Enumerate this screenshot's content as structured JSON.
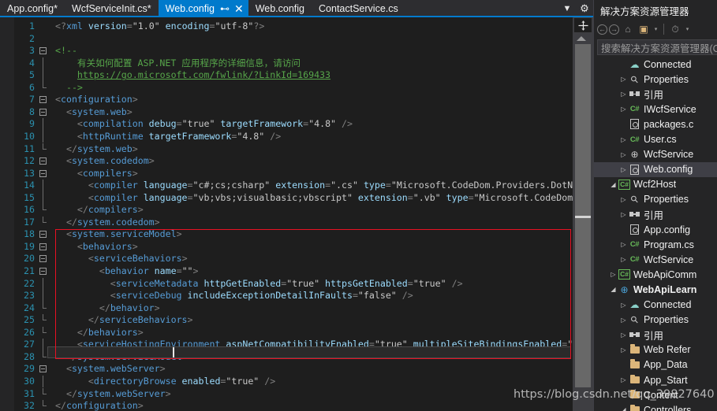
{
  "tabs": [
    {
      "label": "App.config*",
      "active": false
    },
    {
      "label": "WcfServiceInit.cs*",
      "active": false
    },
    {
      "label": "Web.config",
      "active": true,
      "pin": "⊷",
      "close": "✕"
    },
    {
      "label": "Web.config",
      "active": false
    },
    {
      "label": "ContactService.cs",
      "active": false
    }
  ],
  "tabbar_buttons": [
    {
      "name": "tab-list-dropdown",
      "glyph": "▼"
    },
    {
      "name": "tab-settings-gear",
      "glyph": "⚙"
    }
  ],
  "editor": {
    "file": "Web.config",
    "cursor_line": 28,
    "lines": [
      {
        "n": 1,
        "segs": [
          {
            "t": "<?",
            "c": "t-pitext"
          },
          {
            "t": "xml",
            "c": "t-pi"
          },
          {
            "t": " version",
            "c": "t-attr"
          },
          {
            "t": "=",
            "c": "t-punct"
          },
          {
            "t": "\"1.0\"",
            "c": "t-val"
          },
          {
            "t": " encoding",
            "c": "t-attr"
          },
          {
            "t": "=",
            "c": "t-punct"
          },
          {
            "t": "\"utf-8\"",
            "c": "t-val"
          },
          {
            "t": "?>",
            "c": "t-pitext"
          }
        ],
        "indent": 0
      },
      {
        "n": 2,
        "segs": [],
        "indent": 0
      },
      {
        "n": 3,
        "segs": [
          {
            "t": "<!--",
            "c": "t-comment"
          }
        ],
        "indent": 0,
        "fold": "start"
      },
      {
        "n": 4,
        "segs": [
          {
            "t": "    有关如何配置 ASP.NET 应用程序的详细信息，请访问",
            "c": "t-comment"
          }
        ],
        "indent": 0,
        "fold": "bar"
      },
      {
        "n": 5,
        "segs": [
          {
            "t": "    ",
            "c": "t-comment"
          },
          {
            "t": "https://go.microsoft.com/fwlink/?LinkId=169433",
            "c": "t-link"
          }
        ],
        "indent": 0,
        "fold": "bar"
      },
      {
        "n": 6,
        "segs": [
          {
            "t": "  -->",
            "c": "t-comment"
          }
        ],
        "indent": 0,
        "fold": "end"
      },
      {
        "n": 7,
        "segs": [
          {
            "t": "<",
            "c": "t-punct"
          },
          {
            "t": "configuration",
            "c": "t-tag"
          },
          {
            "t": ">",
            "c": "t-punct"
          }
        ],
        "indent": 0,
        "fold": "start"
      },
      {
        "n": 8,
        "segs": [
          {
            "t": "  <",
            "c": "t-punct"
          },
          {
            "t": "system.web",
            "c": "t-tag"
          },
          {
            "t": ">",
            "c": "t-punct"
          }
        ],
        "indent": 0,
        "fold": "start"
      },
      {
        "n": 9,
        "segs": [
          {
            "t": "    <",
            "c": "t-punct"
          },
          {
            "t": "compilation",
            "c": "t-tag"
          },
          {
            "t": " debug",
            "c": "t-attr"
          },
          {
            "t": "=",
            "c": "t-punct"
          },
          {
            "t": "\"true\"",
            "c": "t-val"
          },
          {
            "t": " targetFramework",
            "c": "t-attr"
          },
          {
            "t": "=",
            "c": "t-punct"
          },
          {
            "t": "\"4.8\"",
            "c": "t-val"
          },
          {
            "t": " />",
            "c": "t-punct"
          }
        ],
        "indent": 0,
        "fold": "bar"
      },
      {
        "n": 10,
        "segs": [
          {
            "t": "    <",
            "c": "t-punct"
          },
          {
            "t": "httpRuntime",
            "c": "t-tag"
          },
          {
            "t": " targetFramework",
            "c": "t-attr"
          },
          {
            "t": "=",
            "c": "t-punct"
          },
          {
            "t": "\"4.8\"",
            "c": "t-val"
          },
          {
            "t": " />",
            "c": "t-punct"
          }
        ],
        "indent": 0,
        "fold": "bar"
      },
      {
        "n": 11,
        "segs": [
          {
            "t": "  </",
            "c": "t-punct"
          },
          {
            "t": "system.web",
            "c": "t-tag"
          },
          {
            "t": ">",
            "c": "t-punct"
          }
        ],
        "indent": 0,
        "fold": "end"
      },
      {
        "n": 12,
        "segs": [
          {
            "t": "  <",
            "c": "t-punct"
          },
          {
            "t": "system.codedom",
            "c": "t-tag"
          },
          {
            "t": ">",
            "c": "t-punct"
          }
        ],
        "indent": 0,
        "fold": "start"
      },
      {
        "n": 13,
        "segs": [
          {
            "t": "    <",
            "c": "t-punct"
          },
          {
            "t": "compilers",
            "c": "t-tag"
          },
          {
            "t": ">",
            "c": "t-punct"
          }
        ],
        "indent": 0,
        "fold": "start"
      },
      {
        "n": 14,
        "segs": [
          {
            "t": "      <",
            "c": "t-punct"
          },
          {
            "t": "compiler",
            "c": "t-tag"
          },
          {
            "t": " language",
            "c": "t-attr"
          },
          {
            "t": "=",
            "c": "t-punct"
          },
          {
            "t": "\"c#;cs;csharp\"",
            "c": "t-val"
          },
          {
            "t": " extension",
            "c": "t-attr"
          },
          {
            "t": "=",
            "c": "t-punct"
          },
          {
            "t": "\".cs\"",
            "c": "t-val"
          },
          {
            "t": " type",
            "c": "t-attr"
          },
          {
            "t": "=",
            "c": "t-punct"
          },
          {
            "t": "\"Microsoft.CodeDom.Providers.DotNetCompiler",
            "c": "t-val"
          }
        ],
        "indent": 0,
        "fold": "bar"
      },
      {
        "n": 15,
        "segs": [
          {
            "t": "      <",
            "c": "t-punct"
          },
          {
            "t": "compiler",
            "c": "t-tag"
          },
          {
            "t": " language",
            "c": "t-attr"
          },
          {
            "t": "=",
            "c": "t-punct"
          },
          {
            "t": "\"vb;vbs;visualbasic;vbscript\"",
            "c": "t-val"
          },
          {
            "t": " extension",
            "c": "t-attr"
          },
          {
            "t": "=",
            "c": "t-punct"
          },
          {
            "t": "\".vb\"",
            "c": "t-val"
          },
          {
            "t": " type",
            "c": "t-attr"
          },
          {
            "t": "=",
            "c": "t-punct"
          },
          {
            "t": "\"Microsoft.CodeDom.Providers",
            "c": "t-val"
          }
        ],
        "indent": 0,
        "fold": "bar"
      },
      {
        "n": 16,
        "segs": [
          {
            "t": "    </",
            "c": "t-punct"
          },
          {
            "t": "compilers",
            "c": "t-tag"
          },
          {
            "t": ">",
            "c": "t-punct"
          }
        ],
        "indent": 0,
        "fold": "end"
      },
      {
        "n": 17,
        "segs": [
          {
            "t": "  </",
            "c": "t-punct"
          },
          {
            "t": "system.codedom",
            "c": "t-tag"
          },
          {
            "t": ">",
            "c": "t-punct"
          }
        ],
        "indent": 0,
        "fold": "end"
      },
      {
        "n": 18,
        "segs": [
          {
            "t": "  <",
            "c": "t-punct"
          },
          {
            "t": "system.serviceModel",
            "c": "t-tag"
          },
          {
            "t": ">",
            "c": "t-punct"
          }
        ],
        "indent": 0,
        "fold": "start"
      },
      {
        "n": 19,
        "segs": [
          {
            "t": "    <",
            "c": "t-punct"
          },
          {
            "t": "behaviors",
            "c": "t-tag"
          },
          {
            "t": ">",
            "c": "t-punct"
          }
        ],
        "indent": 0,
        "fold": "start"
      },
      {
        "n": 20,
        "segs": [
          {
            "t": "      <",
            "c": "t-punct"
          },
          {
            "t": "serviceBehaviors",
            "c": "t-tag"
          },
          {
            "t": ">",
            "c": "t-punct"
          }
        ],
        "indent": 0,
        "fold": "start"
      },
      {
        "n": 21,
        "segs": [
          {
            "t": "        <",
            "c": "t-punct"
          },
          {
            "t": "behavior",
            "c": "t-tag"
          },
          {
            "t": " name",
            "c": "t-attr"
          },
          {
            "t": "=",
            "c": "t-punct"
          },
          {
            "t": "\"\"",
            "c": "t-val"
          },
          {
            "t": ">",
            "c": "t-punct"
          }
        ],
        "indent": 0,
        "fold": "start"
      },
      {
        "n": 22,
        "segs": [
          {
            "t": "          <",
            "c": "t-punct"
          },
          {
            "t": "serviceMetadata",
            "c": "t-tag"
          },
          {
            "t": " httpGetEnabled",
            "c": "t-attr"
          },
          {
            "t": "=",
            "c": "t-punct"
          },
          {
            "t": "\"true\"",
            "c": "t-val"
          },
          {
            "t": " httpsGetEnabled",
            "c": "t-attr"
          },
          {
            "t": "=",
            "c": "t-punct"
          },
          {
            "t": "\"true\"",
            "c": "t-val"
          },
          {
            "t": " />",
            "c": "t-punct"
          }
        ],
        "indent": 0,
        "fold": "bar"
      },
      {
        "n": 23,
        "segs": [
          {
            "t": "          <",
            "c": "t-punct"
          },
          {
            "t": "serviceDebug",
            "c": "t-tag"
          },
          {
            "t": " includeExceptionDetailInFaults",
            "c": "t-attr"
          },
          {
            "t": "=",
            "c": "t-punct"
          },
          {
            "t": "\"false\"",
            "c": "t-val"
          },
          {
            "t": " />",
            "c": "t-punct"
          }
        ],
        "indent": 0,
        "fold": "bar"
      },
      {
        "n": 24,
        "segs": [
          {
            "t": "        </",
            "c": "t-punct"
          },
          {
            "t": "behavior",
            "c": "t-tag"
          },
          {
            "t": ">",
            "c": "t-punct"
          }
        ],
        "indent": 0,
        "fold": "end"
      },
      {
        "n": 25,
        "segs": [
          {
            "t": "      </",
            "c": "t-punct"
          },
          {
            "t": "serviceBehaviors",
            "c": "t-tag"
          },
          {
            "t": ">",
            "c": "t-punct"
          }
        ],
        "indent": 0,
        "fold": "end"
      },
      {
        "n": 26,
        "segs": [
          {
            "t": "    </",
            "c": "t-punct"
          },
          {
            "t": "behaviors",
            "c": "t-tag"
          },
          {
            "t": ">",
            "c": "t-punct"
          }
        ],
        "indent": 0,
        "fold": "end"
      },
      {
        "n": 27,
        "segs": [
          {
            "t": "    <",
            "c": "t-punct"
          },
          {
            "t": "serviceHostingEnvironment",
            "c": "t-tag"
          },
          {
            "t": " aspNetCompatibilityEnabled",
            "c": "t-attr"
          },
          {
            "t": "=",
            "c": "t-punct"
          },
          {
            "t": "\"true\"",
            "c": "t-val"
          },
          {
            "t": " multipleSiteBindingsEnabled",
            "c": "t-attr"
          },
          {
            "t": "=",
            "c": "t-punct"
          },
          {
            "t": "\"true\"",
            "c": "t-val"
          },
          {
            "t": " />",
            "c": "t-punct"
          }
        ],
        "indent": 0,
        "fold": "bar"
      },
      {
        "n": 28,
        "segs": [
          {
            "t": "  </",
            "c": "t-punct"
          },
          {
            "t": "system.serviceModel",
            "c": "t-tag"
          },
          {
            "t": ">",
            "c": "t-punct"
          }
        ],
        "indent": 0,
        "fold": "end"
      },
      {
        "n": 29,
        "segs": [
          {
            "t": "  <",
            "c": "t-punct"
          },
          {
            "t": "system.webServer",
            "c": "t-tag"
          },
          {
            "t": ">",
            "c": "t-punct"
          }
        ],
        "indent": 0,
        "fold": "start"
      },
      {
        "n": 30,
        "segs": [
          {
            "t": "      <",
            "c": "t-punct"
          },
          {
            "t": "directoryBrowse",
            "c": "t-tag"
          },
          {
            "t": " enabled",
            "c": "t-attr"
          },
          {
            "t": "=",
            "c": "t-punct"
          },
          {
            "t": "\"true\"",
            "c": "t-val"
          },
          {
            "t": " />",
            "c": "t-punct"
          }
        ],
        "indent": 0,
        "fold": "bar"
      },
      {
        "n": 31,
        "segs": [
          {
            "t": "  </",
            "c": "t-punct"
          },
          {
            "t": "system.webServer",
            "c": "t-tag"
          },
          {
            "t": ">",
            "c": "t-punct"
          }
        ],
        "indent": 0,
        "fold": "end"
      },
      {
        "n": 32,
        "segs": [
          {
            "t": "</",
            "c": "t-punct"
          },
          {
            "t": "configuration",
            "c": "t-tag"
          },
          {
            "t": ">",
            "c": "t-punct"
          }
        ],
        "indent": 0,
        "fold": "end"
      }
    ],
    "annotation_box": {
      "color": "#e81123",
      "from_line": 18,
      "to_line": 28
    }
  },
  "solution_explorer": {
    "title": "解决方案资源管理器",
    "search_placeholder": "搜索解决方案资源管理器(C",
    "toolbar": [
      {
        "name": "nav-back-icon",
        "glyph": "←"
      },
      {
        "name": "nav-forward-icon",
        "glyph": "→"
      },
      {
        "name": "home-icon",
        "glyph": "⌂"
      },
      {
        "name": "sync-with-active-document-icon",
        "glyph": "▣"
      },
      {
        "name": "sync-dropdown-icon",
        "glyph": "▾"
      },
      {
        "name": "pending-changes-filter-icon",
        "glyph": "⏱"
      },
      {
        "name": "filter-dropdown-icon",
        "glyph": "▾"
      }
    ],
    "tree": [
      {
        "label": "Connected",
        "indent": 2,
        "expander": "",
        "icon": "cloud",
        "selected": false,
        "bold": false
      },
      {
        "label": "Properties",
        "indent": 2,
        "expander": "▷",
        "icon": "wrench",
        "selected": false,
        "bold": false
      },
      {
        "label": "引用",
        "indent": 2,
        "expander": "▷",
        "icon": "ref",
        "selected": false,
        "bold": false
      },
      {
        "label": "IWcfService",
        "indent": 2,
        "expander": "▷",
        "icon": "cs",
        "selected": false,
        "bold": false
      },
      {
        "label": "packages.c",
        "indent": 2,
        "expander": "",
        "icon": "cfg",
        "selected": false,
        "bold": false
      },
      {
        "label": "User.cs",
        "indent": 2,
        "expander": "▷",
        "icon": "cs",
        "selected": false,
        "bold": false
      },
      {
        "label": "WcfService",
        "indent": 2,
        "expander": "▷",
        "icon": "globe",
        "selected": false,
        "bold": false
      },
      {
        "label": "Web.config",
        "indent": 2,
        "expander": "▷",
        "icon": "cfg",
        "selected": true,
        "bold": false
      },
      {
        "label": "Wcf2Host",
        "indent": 1,
        "expander": "◢",
        "icon": "csbox",
        "selected": false,
        "bold": false
      },
      {
        "label": "Properties",
        "indent": 2,
        "expander": "▷",
        "icon": "wrench",
        "selected": false,
        "bold": false
      },
      {
        "label": "引用",
        "indent": 2,
        "expander": "▷",
        "icon": "ref",
        "selected": false,
        "bold": false
      },
      {
        "label": "App.config",
        "indent": 2,
        "expander": "",
        "icon": "cfg",
        "selected": false,
        "bold": false
      },
      {
        "label": "Program.cs",
        "indent": 2,
        "expander": "▷",
        "icon": "cs",
        "selected": false,
        "bold": false
      },
      {
        "label": "WcfService",
        "indent": 2,
        "expander": "▷",
        "icon": "cs",
        "selected": false,
        "bold": false
      },
      {
        "label": "WebApiComm",
        "indent": 1,
        "expander": "▷",
        "icon": "csbox",
        "selected": false,
        "bold": false
      },
      {
        "label": "WebApiLearn",
        "indent": 1,
        "expander": "◢",
        "icon": "globeblue",
        "selected": false,
        "bold": true
      },
      {
        "label": "Connected",
        "indent": 2,
        "expander": "▷",
        "icon": "cloud",
        "selected": false,
        "bold": false
      },
      {
        "label": "Properties",
        "indent": 2,
        "expander": "▷",
        "icon": "wrench",
        "selected": false,
        "bold": false
      },
      {
        "label": "引用",
        "indent": 2,
        "expander": "▷",
        "icon": "ref",
        "selected": false,
        "bold": false
      },
      {
        "label": "Web Refer",
        "indent": 2,
        "expander": "▷",
        "icon": "folder",
        "selected": false,
        "bold": false
      },
      {
        "label": "App_Data",
        "indent": 2,
        "expander": "",
        "icon": "folder",
        "selected": false,
        "bold": false
      },
      {
        "label": "App_Start",
        "indent": 2,
        "expander": "▷",
        "icon": "folder",
        "selected": false,
        "bold": false
      },
      {
        "label": "Content",
        "indent": 2,
        "expander": "",
        "icon": "folder",
        "selected": false,
        "bold": false
      },
      {
        "label": "Controllers",
        "indent": 2,
        "expander": "◢",
        "icon": "folder",
        "selected": false,
        "bold": false
      }
    ]
  },
  "watermark": "https://blog.csdn.net/qq_39827640"
}
